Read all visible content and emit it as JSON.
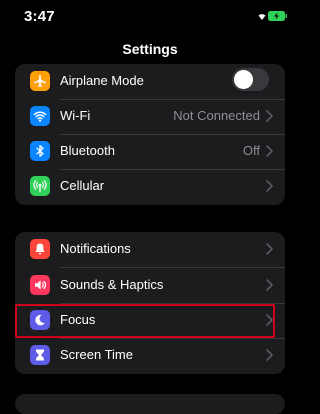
{
  "status": {
    "time": "3:47"
  },
  "nav": {
    "title": "Settings"
  },
  "group1": [
    {
      "label": "Airplane Mode",
      "icon": "airplane-icon",
      "color": "#ff9f0a",
      "toggle": "off"
    },
    {
      "label": "Wi-Fi",
      "icon": "wifi-icon",
      "color": "#0a84ff",
      "value": "Not Connected"
    },
    {
      "label": "Bluetooth",
      "icon": "bluetooth-icon",
      "color": "#0a84ff",
      "value": "Off"
    },
    {
      "label": "Cellular",
      "icon": "cellular-icon",
      "color": "#30d158"
    }
  ],
  "group2": [
    {
      "label": "Notifications",
      "icon": "notification-bell-icon",
      "color": "#ff453a"
    },
    {
      "label": "Sounds & Haptics",
      "icon": "speaker-icon",
      "color": "#ff375f"
    },
    {
      "label": "Focus",
      "icon": "moon-icon",
      "color": "#5e5ce6"
    },
    {
      "label": "Screen Time",
      "icon": "hourglass-icon",
      "color": "#5e5ce6"
    }
  ],
  "colors": {
    "highlight": "#d0021b",
    "battery": "#30d158",
    "background": "#000000",
    "cell": "#1c1c1e"
  }
}
